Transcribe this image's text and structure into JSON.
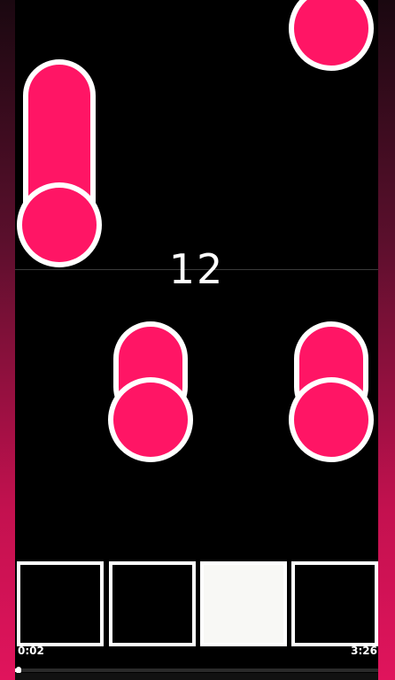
{
  "game": {
    "score": "12",
    "note_color": "#ff1565",
    "note_outline": "#ffffff",
    "lane_count": 4,
    "active_lane_index": 2
  },
  "playback": {
    "elapsed": "0:02",
    "total": "3:26",
    "progress_fraction": 0.01
  },
  "icons": {
    "note": "tap-note-icon",
    "hold_note": "hold-note-icon"
  }
}
